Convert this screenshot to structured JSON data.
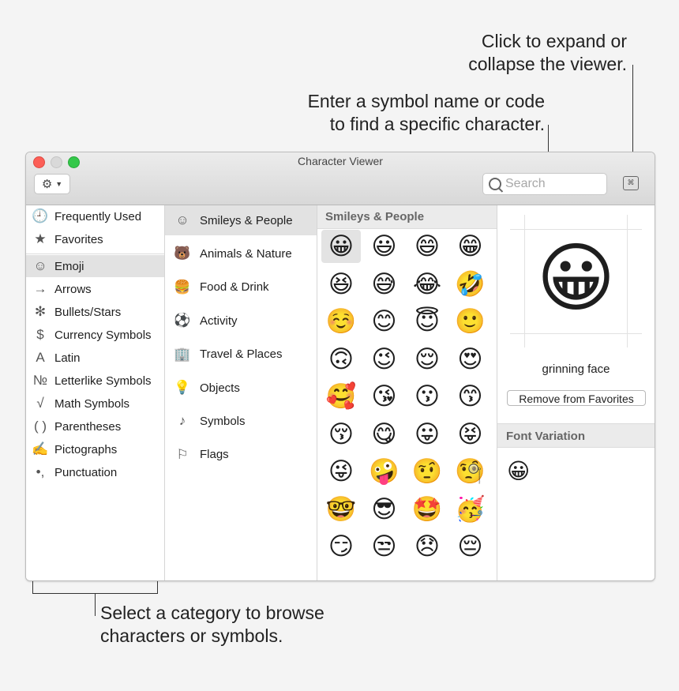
{
  "callouts": {
    "expand": [
      "Click to expand or",
      "collapse the viewer."
    ],
    "search": [
      "Enter a symbol name or code",
      "to find a specific character."
    ],
    "category": [
      "Select a category to browse",
      "characters or symbols."
    ]
  },
  "window": {
    "title": "Character Viewer"
  },
  "toolbar": {
    "search_placeholder": "Search",
    "expand_icon": "⌘"
  },
  "sidebar": {
    "items": [
      {
        "label": "Frequently Used",
        "icon": "🕘",
        "icon_name": "clock-icon"
      },
      {
        "label": "Favorites",
        "icon": "★",
        "icon_name": "star-icon"
      },
      {
        "label": "Emoji",
        "icon": "☺",
        "icon_name": "smiley-icon",
        "selected": true
      },
      {
        "label": "Arrows",
        "icon": "→",
        "icon_name": "arrow-icon"
      },
      {
        "label": "Bullets/Stars",
        "icon": "✻",
        "icon_name": "bullet-star-icon"
      },
      {
        "label": "Currency Symbols",
        "icon": "$",
        "icon_name": "dollar-icon"
      },
      {
        "label": "Latin",
        "icon": "A",
        "icon_name": "latin-icon"
      },
      {
        "label": "Letterlike Symbols",
        "icon": "№",
        "icon_name": "numero-icon"
      },
      {
        "label": "Math Symbols",
        "icon": "√",
        "icon_name": "sqrt-icon"
      },
      {
        "label": "Parentheses",
        "icon": "( )",
        "icon_name": "parentheses-icon"
      },
      {
        "label": "Pictographs",
        "icon": "✍",
        "icon_name": "pictograph-icon"
      },
      {
        "label": "Punctuation",
        "icon": "•,",
        "icon_name": "punctuation-icon"
      }
    ]
  },
  "categories": {
    "items": [
      {
        "label": "Smileys & People",
        "icon": "☺",
        "icon_name": "smiley-face-icon",
        "selected": true
      },
      {
        "label": "Animals & Nature",
        "icon": "🐻",
        "icon_name": "bear-icon"
      },
      {
        "label": "Food & Drink",
        "icon": "🍔",
        "icon_name": "food-icon"
      },
      {
        "label": "Activity",
        "icon": "⚽",
        "icon_name": "soccer-ball-icon"
      },
      {
        "label": "Travel & Places",
        "icon": "🏢",
        "icon_name": "building-icon"
      },
      {
        "label": "Objects",
        "icon": "💡",
        "icon_name": "lightbulb-icon"
      },
      {
        "label": "Symbols",
        "icon": "♪",
        "icon_name": "symbols-icon"
      },
      {
        "label": "Flags",
        "icon": "⚐",
        "icon_name": "flag-icon"
      }
    ]
  },
  "emoji_panel": {
    "header": "Smileys & People",
    "emojis": [
      "😀",
      "😃",
      "😄",
      "😁",
      "😆",
      "😅",
      "😂",
      "🤣",
      "☺️",
      "😊",
      "😇",
      "🙂",
      "🙃",
      "😉",
      "😌",
      "😍",
      "🥰",
      "😘",
      "😗",
      "😙",
      "😚",
      "😋",
      "😛",
      "😝",
      "😜",
      "🤪",
      "🤨",
      "🧐",
      "🤓",
      "😎",
      "🤩",
      "🥳",
      "😏",
      "😒",
      "😞",
      "😔"
    ]
  },
  "detail": {
    "preview_emoji": "😀",
    "name": "grinning face",
    "favorites_button": "Remove from Favorites",
    "font_variation_header": "Font Variation",
    "font_variation_emoji": "😀"
  }
}
